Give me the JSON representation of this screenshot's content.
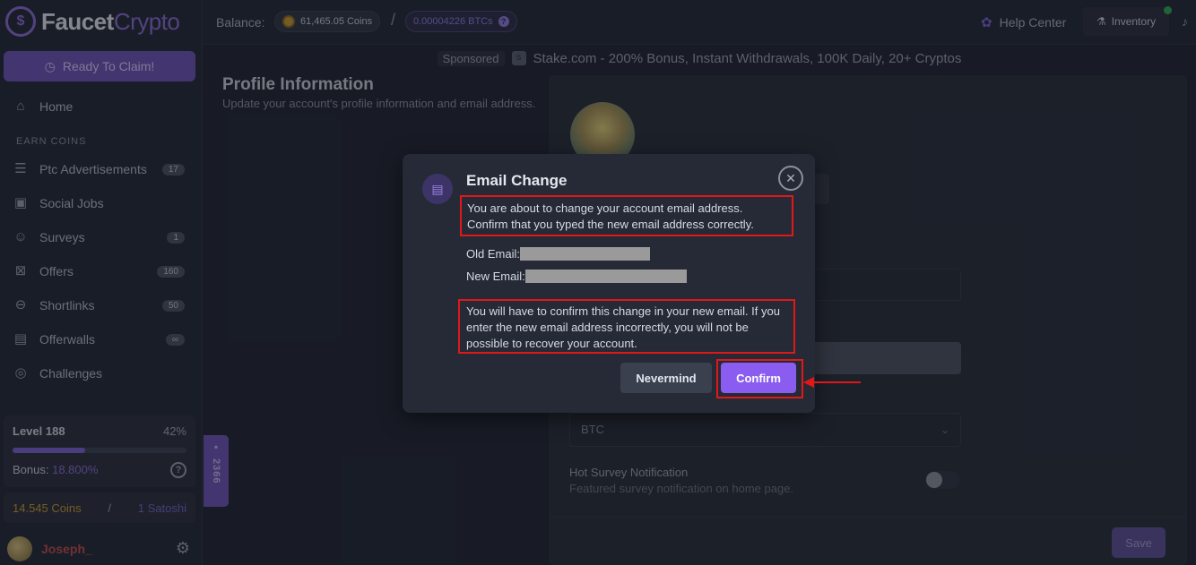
{
  "app": {
    "logo_main": "Faucet",
    "logo_accent": "Crypto"
  },
  "sidebar": {
    "ready_label": "Ready To Claim!",
    "home_label": "Home",
    "section_earn": "EARN COINS",
    "items": [
      {
        "label": "Ptc Advertisements",
        "badge": "17",
        "icon": "ptc-icon"
      },
      {
        "label": "Social Jobs",
        "badge": "",
        "icon": "briefcase-icon"
      },
      {
        "label": "Surveys",
        "badge": "1",
        "icon": "survey-icon"
      },
      {
        "label": "Offers",
        "badge": "160",
        "icon": "ticket-icon"
      },
      {
        "label": "Shortlinks",
        "badge": "50",
        "icon": "link-icon"
      },
      {
        "label": "Offerwalls",
        "badge": "∞",
        "icon": "book-icon"
      },
      {
        "label": "Challenges",
        "badge": "",
        "icon": "target-icon"
      }
    ],
    "level": {
      "label": "Level 188",
      "percent_text": "42%",
      "progress": 0.42,
      "bonus_label": "Bonus:",
      "bonus_value": "18.800%"
    },
    "coins": {
      "coins_text": "14.545 Coins",
      "separator": "/",
      "satoshi_text": "1 Satoshi"
    },
    "user": {
      "name": "Joseph_"
    }
  },
  "topbar": {
    "balance_label": "Balance:",
    "coins_value": "61,465.05 Coins",
    "separator": "/",
    "btc_value": "0.00004226 BTCs",
    "help_label": "Help Center",
    "inventory_label": "Inventory"
  },
  "sponsor": {
    "tag": "Sponsored",
    "text": "Stake.com - 200% Bonus, Instant Withdrawals, 100K Daily, 20+ Cryptos"
  },
  "profile": {
    "title": "Profile Information",
    "subtitle": "Update your account's profile information and email address.",
    "currency_value": "BTC",
    "hot_survey_title": "Hot Survey Notification",
    "hot_survey_sub": "Featured survey notification on home page.",
    "save_label": "Save"
  },
  "side_tab": {
    "count": "2366"
  },
  "modal": {
    "title": "Email Change",
    "message1": "You are about to change your account email address. Confirm that you typed the new email address correctly.",
    "old_email_label": "Old Email:",
    "new_email_label": "New Email:",
    "message2": "You will have to confirm this change in your new email. If you enter the new email address incorrectly, you will not be possible to recover your account.",
    "nevermind_label": "Nevermind",
    "confirm_label": "Confirm"
  },
  "colors": {
    "accent": "#8a5cf0",
    "highlight": "#e01818",
    "background": "#1f2430"
  }
}
